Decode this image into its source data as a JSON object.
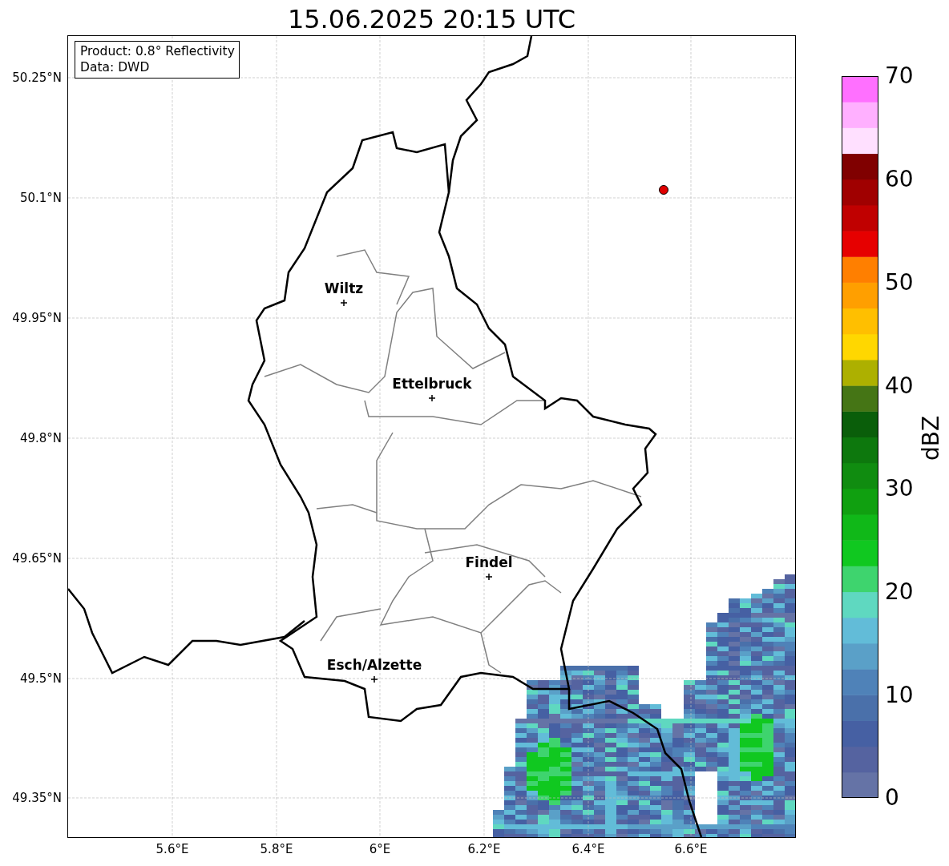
{
  "title": "15.06.2025 20:15 UTC",
  "info_box": [
    "Product: 0.8° Reflectivity",
    "Data: DWD"
  ],
  "lat_ticks": [
    "50.25°N",
    "50.1°N",
    "49.95°N",
    "49.8°N",
    "49.65°N",
    "49.5°N",
    "49.35°N"
  ],
  "lon_ticks": [
    "5.6°E",
    "5.8°E",
    "6°E",
    "6.2°E",
    "6.4°E",
    "6.6°E"
  ],
  "cities": [
    {
      "name": "Wiltz"
    },
    {
      "name": "Ettelbruck"
    },
    {
      "name": "Findel"
    },
    {
      "name": "Esch/Alzette"
    }
  ],
  "colorbar": {
    "label": "dBZ",
    "ticks": [
      "70",
      "60",
      "50",
      "40",
      "30",
      "20",
      "10",
      "0"
    ]
  }
}
